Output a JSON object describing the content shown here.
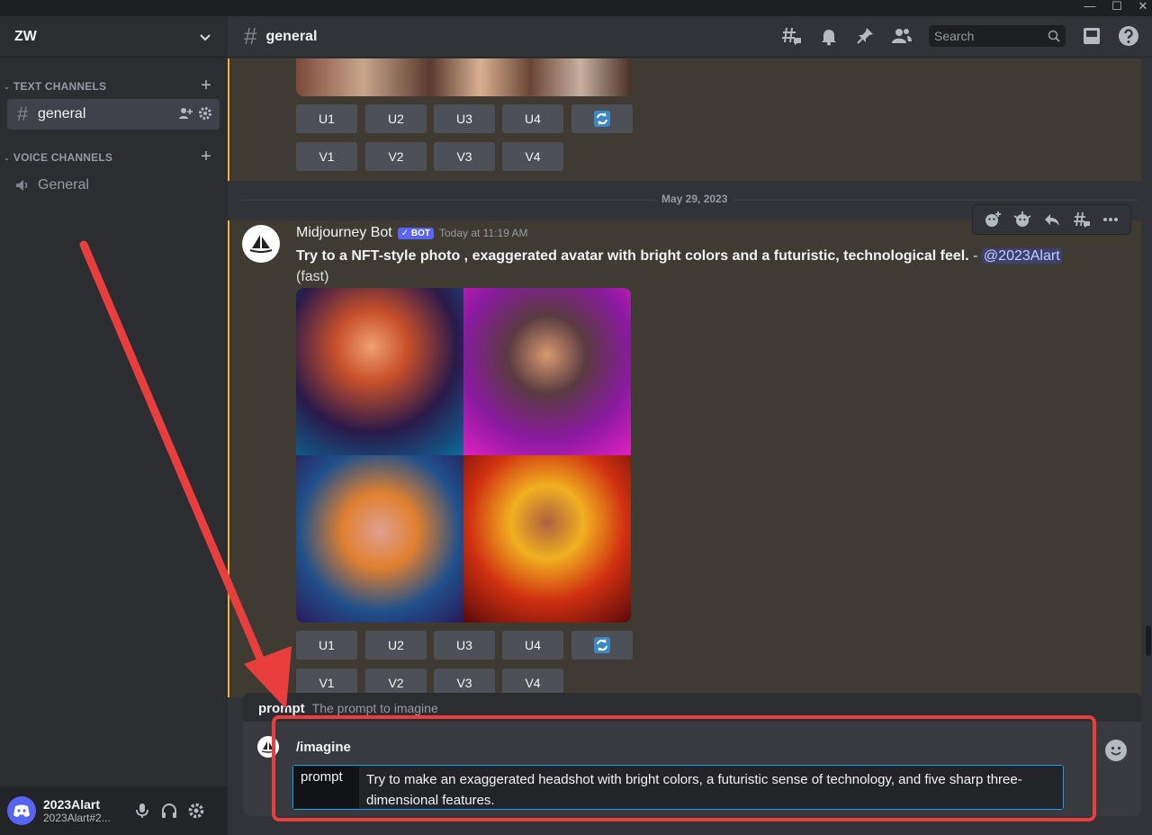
{
  "window": {
    "controls": [
      "—",
      "☐",
      "✕"
    ]
  },
  "server": {
    "name": "ZW"
  },
  "categories": {
    "text": "TEXT CHANNELS",
    "voice": "VOICE CHANNELS"
  },
  "channels": {
    "text": [
      {
        "label": "general"
      }
    ],
    "voice": [
      {
        "label": "General"
      }
    ]
  },
  "user": {
    "name": "2023Alart",
    "tag": "2023Alart#2..."
  },
  "header": {
    "channel": "general",
    "search_placeholder": "Search"
  },
  "buttons": {
    "u1": "U1",
    "u2": "U2",
    "u3": "U3",
    "u4": "U4",
    "v1": "V1",
    "v2": "V2",
    "v3": "V3",
    "v4": "V4"
  },
  "divider": {
    "date": "May 29, 2023"
  },
  "message": {
    "author": "Midjourney Bot",
    "badge": "✓ BOT",
    "timestamp": "Today at 11:19 AM",
    "prompt": "Try to a NFT-style photo , exaggerated avatar with bright colors and a futuristic, technological feel.",
    "separator": " - ",
    "mention": "@2023Alart",
    "mode": "(fast)"
  },
  "composer": {
    "hint_name": "prompt",
    "hint_desc": "The prompt to imagine",
    "command": "/imagine",
    "option_name": "prompt",
    "option_value": "Try to make an exaggerated headshot with bright colors, a futuristic sense of technology, and five sharp three-dimensional features."
  },
  "icons": [
    "hash-icon",
    "bell-icon",
    "pin-icon",
    "members-icon",
    "search-icon",
    "inbox-icon",
    "help-icon",
    "mic-icon",
    "headphones-icon",
    "gear-icon",
    "refresh-icon",
    "emoji-icon",
    "reply-icon",
    "more-icon",
    "add-reaction-icon",
    "threads-icon",
    "speaker-icon",
    "add-member-icon",
    "chevron-down-icon",
    "plus-icon"
  ],
  "colors": {
    "accent": "#5865f2",
    "mention_highlight": "#3f3b33",
    "mention_border": "#f0b232",
    "annotation": "#e83e3e",
    "focus": "#00a8fc"
  }
}
